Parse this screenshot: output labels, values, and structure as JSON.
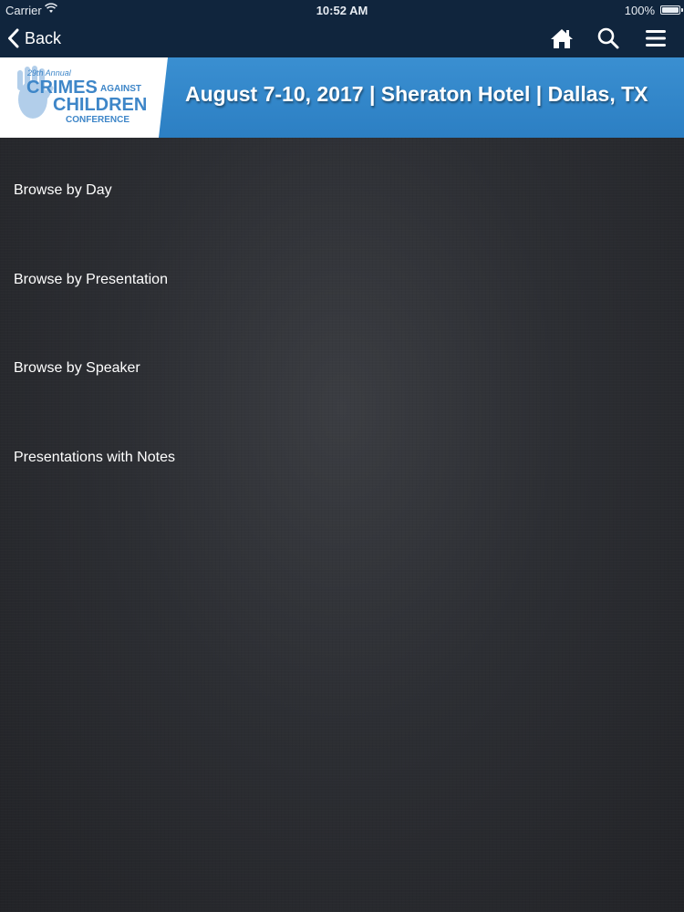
{
  "status_bar": {
    "carrier": "Carrier",
    "time": "10:52 AM",
    "battery": "100%"
  },
  "nav": {
    "back_label": "Back",
    "icons": [
      "home-icon",
      "search-icon",
      "menu-icon"
    ]
  },
  "banner": {
    "logo": {
      "line1": "29th Annual",
      "line2": "CRIMES",
      "line3": "AGAINST",
      "line4": "CHILDREN",
      "line5": "CONFERENCE"
    },
    "title": "August 7-10, 2017 | Sheraton Hotel | Dallas, TX",
    "colors": {
      "banner_blue": "#2f86c9",
      "logo_blue": "#3e86c8"
    }
  },
  "menu": {
    "items": [
      {
        "label": "Browse by Day"
      },
      {
        "label": "Browse by Presentation"
      },
      {
        "label": "Browse by Speaker"
      },
      {
        "label": "Presentations with Notes"
      }
    ]
  },
  "colors": {
    "nav_bg": "#10253d",
    "content_bg": "#2c2e33",
    "text": "#ffffff"
  }
}
